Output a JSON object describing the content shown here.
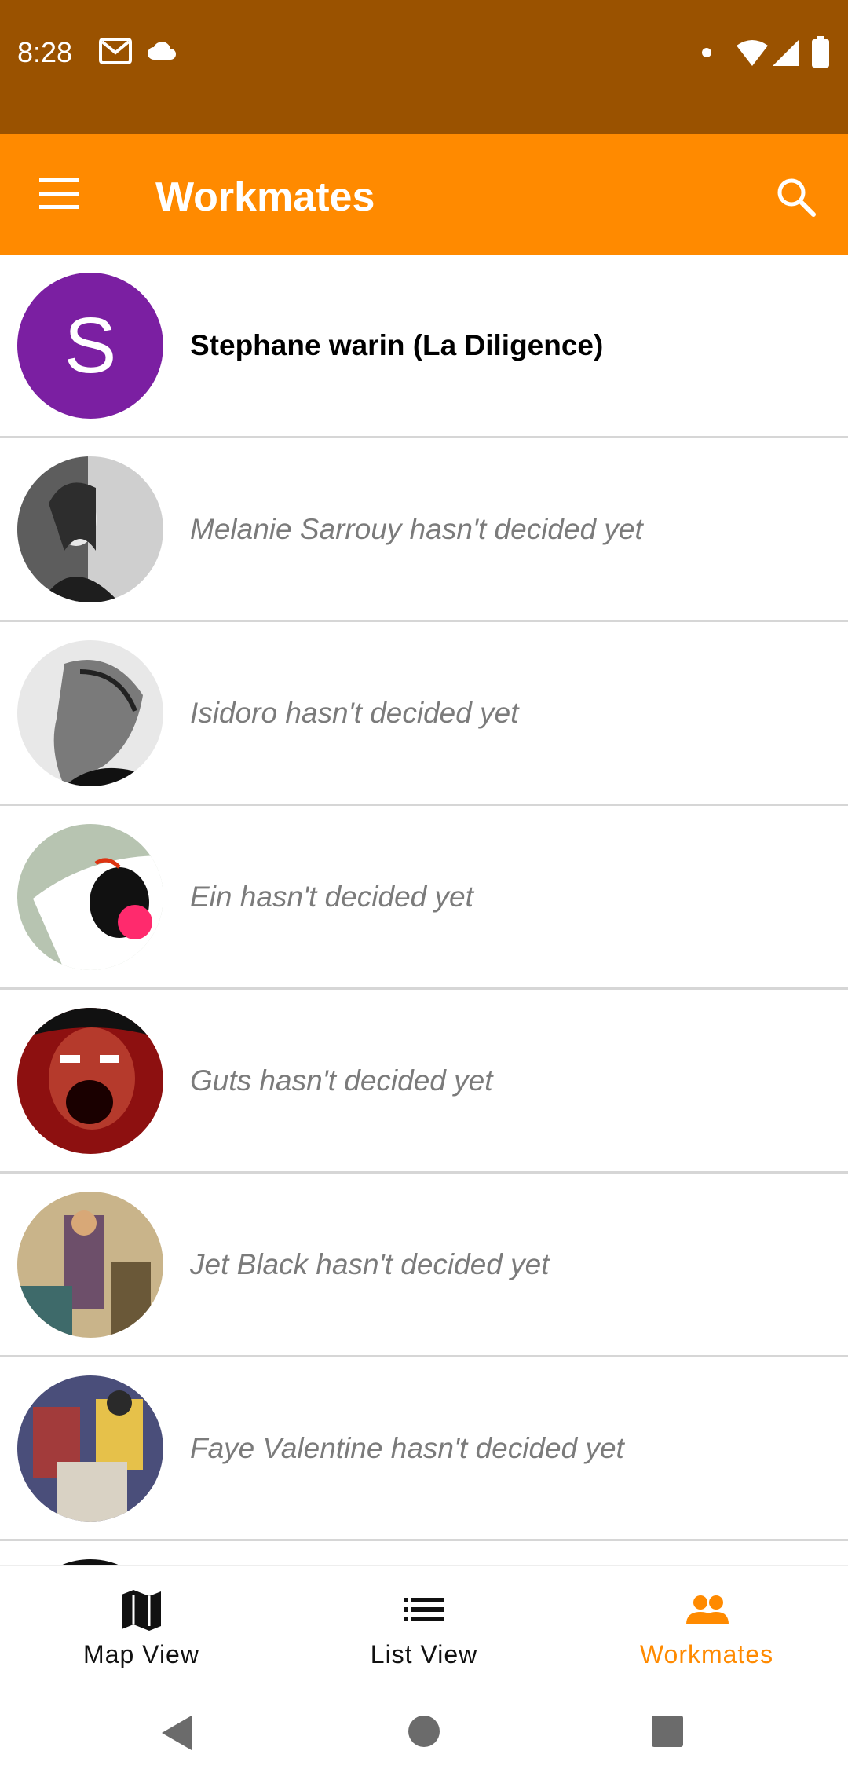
{
  "status_bar": {
    "time": "8:28",
    "icons": [
      "gmail-icon",
      "cloud-icon",
      "dot-icon",
      "wifi-icon",
      "signal-icon",
      "battery-icon"
    ]
  },
  "app_bar": {
    "title": "Workmates",
    "menu_icon": "menu-icon",
    "search_icon": "search-icon"
  },
  "workmates": [
    {
      "name_line": "Stephane warin (La Diligence)",
      "avatar_letter": "S",
      "decided": true
    },
    {
      "name_line": "Melanie Sarrouy hasn't decided yet",
      "decided": false
    },
    {
      "name_line": "Isidoro hasn't decided yet",
      "decided": false
    },
    {
      "name_line": "Ein hasn't decided yet",
      "decided": false
    },
    {
      "name_line": "Guts hasn't decided yet",
      "decided": false
    },
    {
      "name_line": "Jet Black hasn't decided yet",
      "decided": false
    },
    {
      "name_line": "Faye Valentine hasn't decided yet",
      "decided": false
    }
  ],
  "bottom_nav": {
    "items": [
      {
        "label": "Map View",
        "icon": "map-icon"
      },
      {
        "label": "List View",
        "icon": "list-icon"
      },
      {
        "label": "Workmates",
        "icon": "people-icon",
        "active": true
      }
    ]
  },
  "colors": {
    "status_bar": "#9A5200",
    "app_bar": "#FF8A00",
    "active_nav": "#FF8A00",
    "avatar_purple": "#7B1FA2"
  }
}
